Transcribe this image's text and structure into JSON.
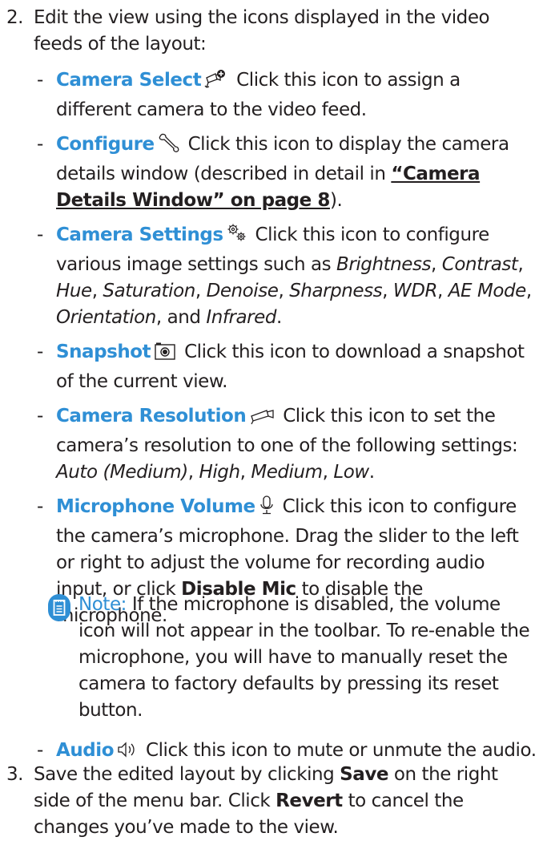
{
  "step2": {
    "number": "2.",
    "text": "Edit the view using the icons displayed in the video feeds of the layout:"
  },
  "items": [
    {
      "dash": "-",
      "term": "Camera Select",
      "icon": "camera-select-icon",
      "text": "Click this icon to assign a different camera to the video feed."
    },
    {
      "dash": "-",
      "term": "Configure",
      "icon": "wrench-icon",
      "text_before": "Click this icon to display the camera details window (described in detail in ",
      "link": "“Camera Details Window” on page 8",
      "text_after": ")."
    },
    {
      "dash": "-",
      "term": "Camera Settings",
      "icon": "gears-icon",
      "text_before": "Click this icon to configure various image settings such as ",
      "settings": [
        "Brightness",
        "Contrast",
        "Hue",
        "Saturation",
        "Denoise",
        "Sharpness",
        "WDR",
        "AE Mode",
        "Orientation",
        "Infrared"
      ],
      "sep": ", ",
      "and": ", and ",
      "end": "."
    },
    {
      "dash": "-",
      "term": "Snapshot",
      "icon": "snapshot-icon",
      "text": "Click this icon to download a snapshot of the current view."
    },
    {
      "dash": "-",
      "term": "Camera Resolution",
      "icon": "camera-outline-icon",
      "text_before": "Click this icon to set the camera’s resolution to one of the following settings: ",
      "options": [
        "Auto (Medium)",
        "High",
        "Medium",
        "Low"
      ],
      "sep": ", ",
      "end": "."
    },
    {
      "dash": "-",
      "term": "Microphone Volume",
      "icon": "microphone-icon",
      "text_before": "Click this icon to configure the camera’s microphone. Drag the slider to the left or right to adjust the volume for recording audio input, or click ",
      "bold": "Disable Mic",
      "text_after": " to disable the microphone."
    }
  ],
  "note": {
    "icon": "note-icon",
    "label": "Note:",
    "text": " If the microphone is disabled, the volume icon will not appear in the toolbar. To re-enable the microphone, you will have to manually reset the camera to factory defaults by pressing its reset button."
  },
  "audio": {
    "dash": "-",
    "term": "Audio",
    "icon": "speaker-icon",
    "text": "Click this icon to mute or unmute the audio."
  },
  "step3": {
    "number": "3.",
    "before": "Save the edited layout by clicking ",
    "save": "Save",
    "middle": " on the right side of the menu bar. Click ",
    "revert": "Revert",
    "after": " to cancel the changes you’ve made to the view."
  },
  "colors": {
    "accent": "#2f8fd5",
    "text": "#231f20"
  }
}
